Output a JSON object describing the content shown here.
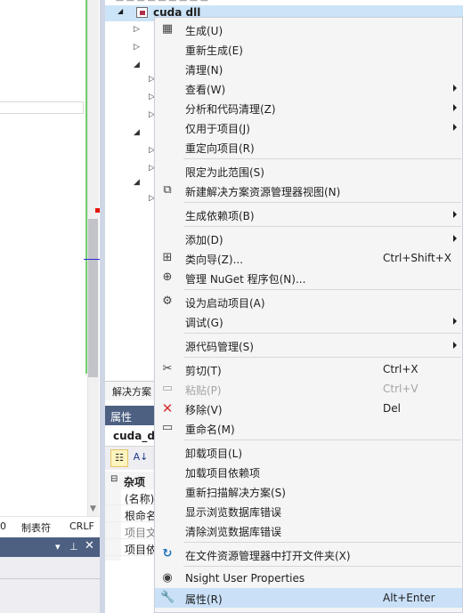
{
  "colors": {
    "menu_background": "#f5f5f5",
    "menu_highlight": "#c9e0f7",
    "panel_header": "#4d6082",
    "selection": "#cce4f7",
    "git_added": "#6fd06f",
    "error_marker": "#e51400",
    "remove_icon": "#d32f2f",
    "open_folder_icon": "#1e73be"
  },
  "status_bar": {
    "column": "0",
    "indent": "制表符",
    "line_ending": "CRLF"
  },
  "bottom_panel": {
    "pin_icon": "pin-icon",
    "close_icon": "close-icon",
    "menu_icon": "dropdown-icon"
  },
  "solution_explorer": {
    "project_name": "cuda dll",
    "tab_label": "解决方案"
  },
  "properties": {
    "title": "属性",
    "object": "cuda_dl",
    "category": "杂项",
    "rows": [
      "(名称)",
      "根命名",
      "项目文",
      "项目依"
    ]
  },
  "context_menu": {
    "items": [
      {
        "label": "生成(U)",
        "shortcut": "",
        "submenu": false,
        "icon": "build-icon",
        "enabled": true
      },
      {
        "label": "重新生成(E)",
        "shortcut": "",
        "submenu": false,
        "icon": "",
        "enabled": true
      },
      {
        "label": "清理(N)",
        "shortcut": "",
        "submenu": false,
        "icon": "",
        "enabled": true
      },
      {
        "label": "查看(W)",
        "shortcut": "",
        "submenu": true,
        "icon": "",
        "enabled": true
      },
      {
        "label": "分析和代码清理(Z)",
        "shortcut": "",
        "submenu": true,
        "icon": "",
        "enabled": true
      },
      {
        "label": "仅用于项目(J)",
        "shortcut": "",
        "submenu": true,
        "icon": "",
        "enabled": true
      },
      {
        "label": "重定向项目(R)",
        "shortcut": "",
        "submenu": false,
        "icon": "",
        "enabled": true
      },
      {
        "label": "限定为此范围(S)",
        "shortcut": "",
        "submenu": false,
        "icon": "",
        "enabled": true
      },
      {
        "label": "新建解决方案资源管理器视图(N)",
        "shortcut": "",
        "submenu": false,
        "icon": "new-view-icon",
        "enabled": true
      },
      {
        "label": "生成依赖项(B)",
        "shortcut": "",
        "submenu": true,
        "icon": "",
        "enabled": true
      },
      {
        "label": "添加(D)",
        "shortcut": "",
        "submenu": true,
        "icon": "",
        "enabled": true
      },
      {
        "label": "类向导(Z)...",
        "shortcut": "Ctrl+Shift+X",
        "submenu": false,
        "icon": "class-wizard-icon",
        "enabled": true
      },
      {
        "label": "管理 NuGet 程序包(N)...",
        "shortcut": "",
        "submenu": false,
        "icon": "nuget-icon",
        "enabled": true
      },
      {
        "label": "设为启动项目(A)",
        "shortcut": "",
        "submenu": false,
        "icon": "gear-icon",
        "enabled": true
      },
      {
        "label": "调试(G)",
        "shortcut": "",
        "submenu": true,
        "icon": "",
        "enabled": true
      },
      {
        "label": "源代码管理(S)",
        "shortcut": "",
        "submenu": true,
        "icon": "",
        "enabled": true
      },
      {
        "label": "剪切(T)",
        "shortcut": "Ctrl+X",
        "submenu": false,
        "icon": "scissors-icon",
        "enabled": true
      },
      {
        "label": "粘贴(P)",
        "shortcut": "Ctrl+V",
        "submenu": false,
        "icon": "paste-icon",
        "enabled": false
      },
      {
        "label": "移除(V)",
        "shortcut": "Del",
        "submenu": false,
        "icon": "remove-icon",
        "enabled": true
      },
      {
        "label": "重命名(M)",
        "shortcut": "",
        "submenu": false,
        "icon": "rename-icon",
        "enabled": true
      },
      {
        "label": "卸载项目(L)",
        "shortcut": "",
        "submenu": false,
        "icon": "",
        "enabled": true
      },
      {
        "label": "加载项目依赖项",
        "shortcut": "",
        "submenu": false,
        "icon": "",
        "enabled": true
      },
      {
        "label": "重新扫描解决方案(S)",
        "shortcut": "",
        "submenu": false,
        "icon": "",
        "enabled": true
      },
      {
        "label": "显示浏览数据库错误",
        "shortcut": "",
        "submenu": false,
        "icon": "",
        "enabled": true
      },
      {
        "label": "清除浏览数据库错误",
        "shortcut": "",
        "submenu": false,
        "icon": "",
        "enabled": true
      },
      {
        "label": "在文件资源管理器中打开文件夹(X)",
        "shortcut": "",
        "submenu": false,
        "icon": "open-folder-icon",
        "enabled": true
      },
      {
        "label": "Nsight User Properties",
        "shortcut": "",
        "submenu": false,
        "icon": "nsight-icon",
        "enabled": true
      },
      {
        "label": "属性(R)",
        "shortcut": "Alt+Enter",
        "submenu": false,
        "icon": "wrench-icon",
        "enabled": true,
        "highlighted": true
      }
    ]
  }
}
